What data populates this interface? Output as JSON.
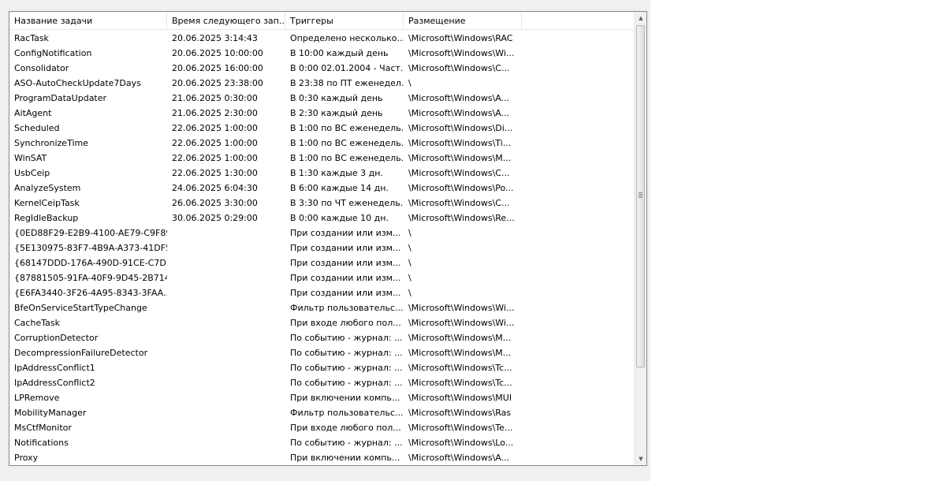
{
  "columns": [
    "Название задачи",
    "Время следующего зап...",
    "Триггеры",
    "Размещение"
  ],
  "rows": [
    [
      "RacTask",
      "20.06.2025 3:14:43",
      "Определено несколько...",
      "\\Microsoft\\Windows\\RAC"
    ],
    [
      "ConfigNotification",
      "20.06.2025 10:00:00",
      "В 10:00 каждый день",
      "\\Microsoft\\Windows\\Wi..."
    ],
    [
      "Consolidator",
      "20.06.2025 16:00:00",
      "В 0:00 02.01.2004 - Част...",
      "\\Microsoft\\Windows\\C..."
    ],
    [
      "ASO-AutoCheckUpdate7Days",
      "20.06.2025 23:38:00",
      "В 23:38 по ПТ еженедел...",
      "\\"
    ],
    [
      "ProgramDataUpdater",
      "21.06.2025 0:30:00",
      "В 0:30 каждый день",
      "\\Microsoft\\Windows\\A..."
    ],
    [
      "AitAgent",
      "21.06.2025 2:30:00",
      "В 2:30 каждый день",
      "\\Microsoft\\Windows\\A..."
    ],
    [
      "Scheduled",
      "22.06.2025 1:00:00",
      "В 1:00 по ВС еженедель...",
      "\\Microsoft\\Windows\\Di..."
    ],
    [
      "SynchronizeTime",
      "22.06.2025 1:00:00",
      "В 1:00 по ВС еженедель...",
      "\\Microsoft\\Windows\\Ti..."
    ],
    [
      "WinSAT",
      "22.06.2025 1:00:00",
      "В 1:00 по ВС еженедель...",
      "\\Microsoft\\Windows\\M..."
    ],
    [
      "UsbCeip",
      "22.06.2025 1:30:00",
      "В 1:30 каждые 3 дн.",
      "\\Microsoft\\Windows\\C..."
    ],
    [
      "AnalyzeSystem",
      "24.06.2025 6:04:30",
      "В 6:00 каждые 14 дн.",
      "\\Microsoft\\Windows\\Po..."
    ],
    [
      "KernelCeipTask",
      "26.06.2025 3:30:00",
      "В 3:30 по ЧТ еженедель...",
      "\\Microsoft\\Windows\\C..."
    ],
    [
      "RegIdleBackup",
      "30.06.2025 0:29:00",
      "В 0:00 каждые 10 дн.",
      "\\Microsoft\\Windows\\Re..."
    ],
    [
      "{0ED88F29-E2B9-4100-AE79-C9F89...",
      "",
      "При создании или изм...",
      "\\"
    ],
    [
      "{5E130975-83F7-4B9A-A373-41DF5...",
      "",
      "При создании или изм...",
      "\\"
    ],
    [
      "{68147DDD-176A-490D-91CE-C7D...",
      "",
      "При создании или изм...",
      "\\"
    ],
    [
      "{87881505-91FA-40F9-9D45-2B714...",
      "",
      "При создании или изм...",
      "\\"
    ],
    [
      "{E6FA3440-3F26-4A95-8343-3FAA...",
      "",
      "При создании или изм...",
      "\\"
    ],
    [
      "BfeOnServiceStartTypeChange",
      "",
      "Фильтр пользовательс...",
      "\\Microsoft\\Windows\\Wi..."
    ],
    [
      "CacheTask",
      "",
      "При входе любого пол...",
      "\\Microsoft\\Windows\\Wi..."
    ],
    [
      "CorruptionDetector",
      "",
      "По событию - журнал: ...",
      "\\Microsoft\\Windows\\M..."
    ],
    [
      "DecompressionFailureDetector",
      "",
      "По событию - журнал: ...",
      "\\Microsoft\\Windows\\M..."
    ],
    [
      "IpAddressConflict1",
      "",
      "По событию - журнал: ...",
      "\\Microsoft\\Windows\\Tc..."
    ],
    [
      "IpAddressConflict2",
      "",
      "По событию - журнал: ...",
      "\\Microsoft\\Windows\\Tc..."
    ],
    [
      "LPRemove",
      "",
      "При включении компь...",
      "\\Microsoft\\Windows\\MUI"
    ],
    [
      "MobilityManager",
      "",
      "Фильтр пользовательс...",
      "\\Microsoft\\Windows\\Ras"
    ],
    [
      "MsCtfMonitor",
      "",
      "При входе любого пол...",
      "\\Microsoft\\Windows\\Te..."
    ],
    [
      "Notifications",
      "",
      "По событию - журнал: ...",
      "\\Microsoft\\Windows\\Lo..."
    ],
    [
      "Proxy",
      "",
      "При включении компь...",
      "\\Microsoft\\Windows\\A..."
    ]
  ],
  "scrollbar": {
    "up_glyph": "▲",
    "down_glyph": "▼",
    "position_fraction": 0.0
  }
}
